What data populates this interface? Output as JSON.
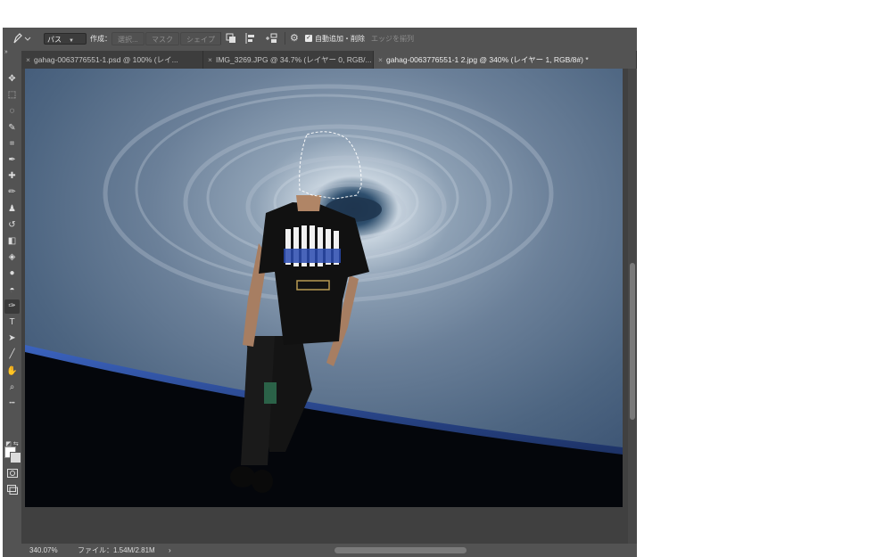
{
  "options_bar": {
    "pen_tool_icon": "pen-icon",
    "mode_value": "パス",
    "make_label": "作成：",
    "selection_button": "選択...",
    "mask_button": "マスク",
    "shape_button": "シェイプ",
    "auto_add_delete_label": "自動追加・削除",
    "align_edges_label": "エッジを揃列"
  },
  "tabs": [
    {
      "label": "gahag-0063776551-1.psd @ 100% (レイ...",
      "active": false
    },
    {
      "label": "IMG_3269.JPG @ 34.7% (レイヤー 0, RGB/...",
      "active": false
    },
    {
      "label": "gahag-0063776551-1 2.jpg @ 340% (レイヤー 1, RGB/8#) *",
      "active": true
    }
  ],
  "toolbar": {
    "tools": [
      {
        "name": "move-tool",
        "glyph": "✥"
      },
      {
        "name": "marquee-tool",
        "glyph": "⬚"
      },
      {
        "name": "lasso-tool",
        "glyph": "◌"
      },
      {
        "name": "quick-select-tool",
        "glyph": "✎"
      },
      {
        "name": "crop-tool",
        "glyph": "⌗"
      },
      {
        "name": "eyedropper-tool",
        "glyph": "✒"
      },
      {
        "name": "healing-tool",
        "glyph": "✚"
      },
      {
        "name": "brush-tool",
        "glyph": "✏"
      },
      {
        "name": "stamp-tool",
        "glyph": "♟"
      },
      {
        "name": "history-brush-tool",
        "glyph": "↺"
      },
      {
        "name": "eraser-tool",
        "glyph": "◧"
      },
      {
        "name": "paint-bucket-tool",
        "glyph": "◈"
      },
      {
        "name": "blur-tool",
        "glyph": "●"
      },
      {
        "name": "dodge-tool",
        "glyph": "◓"
      },
      {
        "name": "pen-tool",
        "glyph": "✑",
        "active": true
      },
      {
        "name": "type-tool",
        "glyph": "T"
      },
      {
        "name": "path-select-tool",
        "glyph": "➤"
      },
      {
        "name": "line-tool",
        "glyph": "╱"
      },
      {
        "name": "hand-tool",
        "glyph": "✋"
      },
      {
        "name": "zoom-tool",
        "glyph": "⌕"
      },
      {
        "name": "more-tools",
        "glyph": "•••"
      }
    ],
    "colors": {
      "foreground": "#ffffff",
      "background": "#dcdcdc"
    }
  },
  "status_bar": {
    "zoom": "340.07%",
    "file_info": "ファイル：1.54M/2.81M",
    "arrow": "›"
  },
  "colors": {
    "ui_panel": "#535353",
    "canvas_bg": "#404040",
    "tab_bar": "#3d3d3d",
    "space_black": "#05070c",
    "atmosphere_blue": "#2a54b8"
  }
}
